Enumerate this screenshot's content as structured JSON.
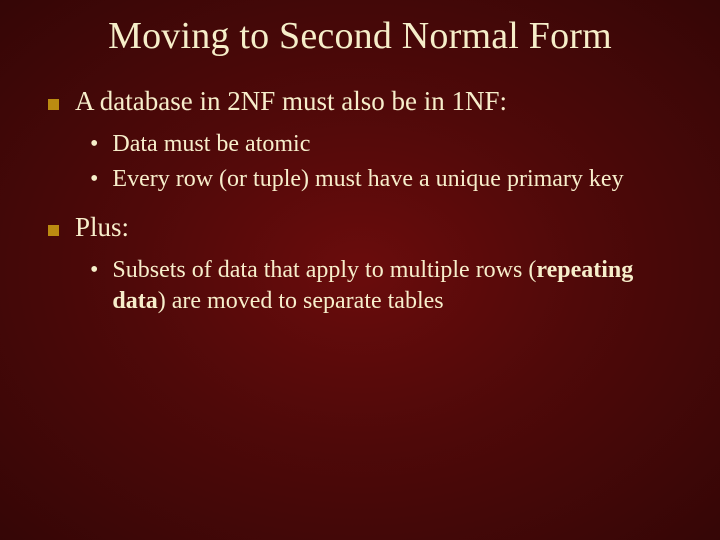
{
  "title": "Moving to Second Normal Form",
  "points": {
    "p1": "A database in 2NF must also be in 1NF:",
    "p1_sub1": "Data must be atomic",
    "p1_sub2": "Every row (or tuple) must have a unique primary key",
    "p2": "Plus:",
    "p2_sub1_a": "Subsets of data that apply to multiple rows (",
    "p2_sub1_b": "repeating data",
    "p2_sub1_c": ") are moved to separate tables"
  }
}
